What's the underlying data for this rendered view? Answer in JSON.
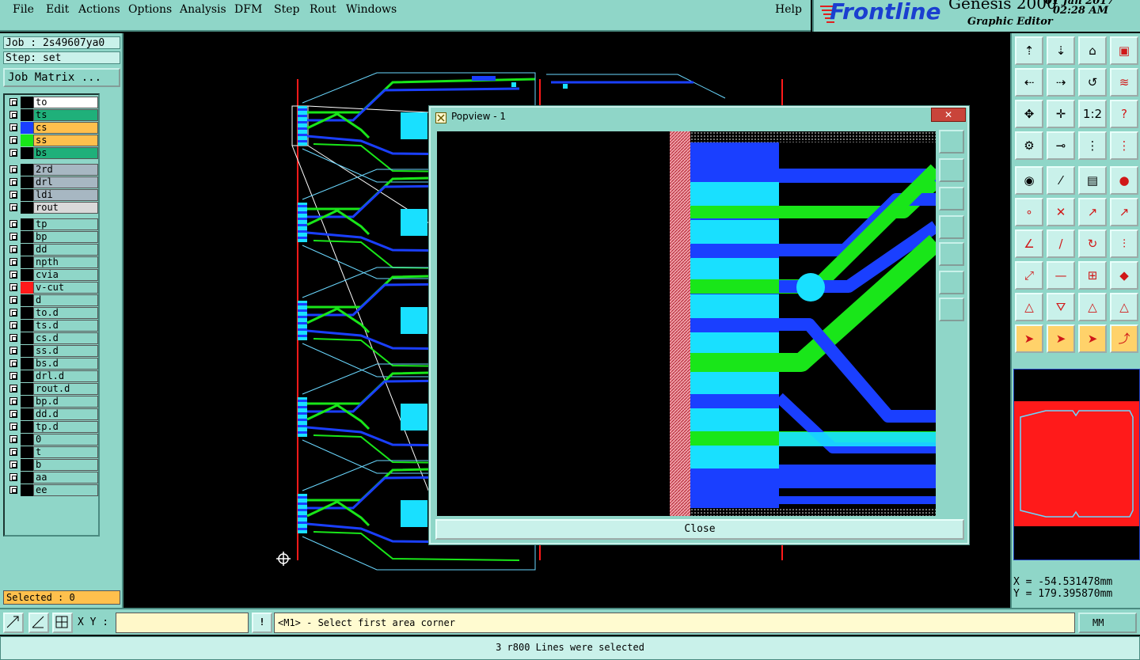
{
  "menubar": {
    "items": [
      "File",
      "Edit",
      "Actions",
      "Options",
      "Analysis",
      "DFM",
      "Step",
      "Rout",
      "Windows"
    ],
    "help": "Help"
  },
  "brand": {
    "logo": "Frontline",
    "product": "Genesis 2000",
    "date": "01 Jan 2017",
    "time": "02:28 AM",
    "subtitle": "Graphic Editor"
  },
  "job": {
    "job_label": "Job : 2s49607ya0",
    "step_label": "Step: set",
    "matrix_button": "Job Matrix ..."
  },
  "layers": [
    {
      "name": "to",
      "swatch": "#000000",
      "bg": "#ffffff"
    },
    {
      "name": "ts",
      "swatch": "#000000",
      "bg": "#1fb07a"
    },
    {
      "name": "cs",
      "swatch": "#1a3fff",
      "bg": "#ffc04d"
    },
    {
      "name": "ss",
      "swatch": "#19e619",
      "bg": "#ffc04d"
    },
    {
      "name": "bs",
      "swatch": "#000000",
      "bg": "#1fb07a"
    },
    {
      "name": "2rd",
      "swatch": "#000000",
      "bg": "#a7b7c2"
    },
    {
      "name": "drl",
      "swatch": "#000000",
      "bg": "#a7b7c2"
    },
    {
      "name": "ldi",
      "swatch": "#000000",
      "bg": "#a7b7c2"
    },
    {
      "name": "rout",
      "swatch": "#000000",
      "bg": "#d9d9d9"
    },
    {
      "name": "tp",
      "swatch": "#000000",
      "bg": "#8fd6c8"
    },
    {
      "name": "bp",
      "swatch": "#000000",
      "bg": "#8fd6c8"
    },
    {
      "name": "dd",
      "swatch": "#000000",
      "bg": "#8fd6c8"
    },
    {
      "name": "npth",
      "swatch": "#000000",
      "bg": "#8fd6c8"
    },
    {
      "name": "cvia",
      "swatch": "#000000",
      "bg": "#8fd6c8"
    },
    {
      "name": "v-cut",
      "swatch": "#ff1a1a",
      "bg": "#8fd6c8"
    },
    {
      "name": "d",
      "swatch": "#000000",
      "bg": "#8fd6c8"
    },
    {
      "name": "to.d",
      "swatch": "#000000",
      "bg": "#8fd6c8"
    },
    {
      "name": "ts.d",
      "swatch": "#000000",
      "bg": "#8fd6c8"
    },
    {
      "name": "cs.d",
      "swatch": "#000000",
      "bg": "#8fd6c8"
    },
    {
      "name": "ss.d",
      "swatch": "#000000",
      "bg": "#8fd6c8"
    },
    {
      "name": "bs.d",
      "swatch": "#000000",
      "bg": "#8fd6c8"
    },
    {
      "name": "drl.d",
      "swatch": "#000000",
      "bg": "#8fd6c8"
    },
    {
      "name": "rout.d",
      "swatch": "#000000",
      "bg": "#8fd6c8"
    },
    {
      "name": "bp.d",
      "swatch": "#000000",
      "bg": "#8fd6c8"
    },
    {
      "name": "dd.d",
      "swatch": "#000000",
      "bg": "#8fd6c8"
    },
    {
      "name": "tp.d",
      "swatch": "#000000",
      "bg": "#8fd6c8"
    },
    {
      "name": "0",
      "swatch": "#000000",
      "bg": "#8fd6c8"
    },
    {
      "name": "t",
      "swatch": "#000000",
      "bg": "#8fd6c8"
    },
    {
      "name": "b",
      "swatch": "#000000",
      "bg": "#8fd6c8"
    },
    {
      "name": "aa",
      "swatch": "#000000",
      "bg": "#8fd6c8"
    },
    {
      "name": "ee",
      "swatch": "#000000",
      "bg": "#8fd6c8"
    }
  ],
  "selected": "Selected : 0",
  "popup": {
    "title": "Popview - 1",
    "close_x": "✕",
    "close_button": "Close"
  },
  "coords": {
    "x": "X = -54.531478mm",
    "y": "Y = 179.395870mm"
  },
  "cmd": {
    "xy_label": "X Y :",
    "xy_value": "",
    "prompt_icon": "!",
    "prompt": "<M1> - Select first area corner",
    "units": "MM"
  },
  "status": "3 r800 Lines were selected",
  "colors": {
    "panel": "#8fd6c8",
    "panel_light": "#c9f1ea",
    "signal_blue": "#1a3fff",
    "signal_green": "#19e619",
    "pad_cyan": "#19e0ff",
    "vcut_red": "#ff1a1a"
  }
}
